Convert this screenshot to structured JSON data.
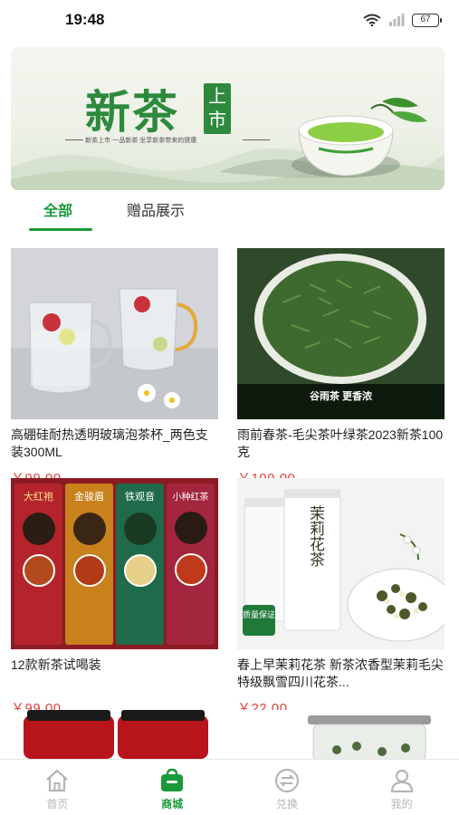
{
  "status": {
    "time": "19:48",
    "battery": "67"
  },
  "banner": {
    "title": "新茶",
    "seal": "上市",
    "subtitle": "新茶上市·一品新茶 坐享新茶带来的健康"
  },
  "tabs": [
    {
      "label": "全部"
    },
    {
      "label": "赠品展示"
    }
  ],
  "products": [
    {
      "title": "高硼硅耐热透明玻璃泡茶杯_两色支装300ML",
      "price": "￥99.00"
    },
    {
      "title": "雨前春茶-毛尖茶叶绿茶2023新茶100克",
      "price": "￥199.00",
      "img_caption": "谷雨茶 更香浓"
    },
    {
      "title": "12款新茶试喝装",
      "price": "￥99.00",
      "img_labels": [
        "大红袍",
        "金骏眉",
        "铁观音",
        "小种红茶"
      ]
    },
    {
      "title": "春上早茉莉花茶 新茶浓香型茉莉毛尖特级飘雪四川花茶...",
      "price": "￥22.00",
      "img_text": "茉莉花茶",
      "img_badge": "质量保证"
    }
  ],
  "tabbar": [
    {
      "label": "首页",
      "icon": "home-icon"
    },
    {
      "label": "商城",
      "icon": "shop-bag-icon"
    },
    {
      "label": "兑换",
      "icon": "exchange-icon"
    },
    {
      "label": "我的",
      "icon": "person-icon"
    }
  ],
  "colors": {
    "accent": "#1a9a3a",
    "price": "#e0423a"
  }
}
